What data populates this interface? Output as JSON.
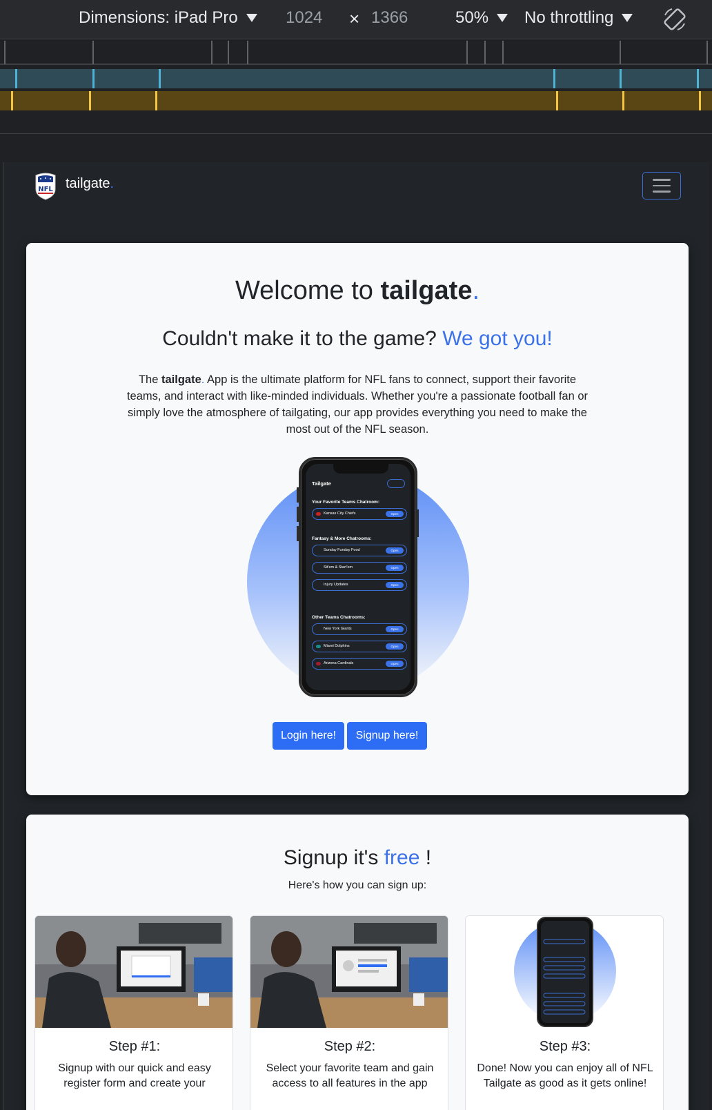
{
  "devtools": {
    "dimensions_label": "Dimensions: iPad Pro",
    "width_value": "1024",
    "times": "×",
    "height_value": "1366",
    "zoom": "50%",
    "throttling": "No throttling",
    "rotate_icon": "rotate-icon"
  },
  "navbar": {
    "brand": "tailgate",
    "brand_dot": ".",
    "logo_icon": "nfl-shield-icon",
    "menu_icon": "hamburger-icon"
  },
  "hero": {
    "title_prefix": "Welcome to ",
    "title_brand": "tailgate",
    "title_dot": ".",
    "subtitle_prefix": "Couldn't make it to the game? ",
    "subtitle_highlight": "We got you!",
    "para_prefix": "The ",
    "para_brand": "tailgate",
    "para_dot": ".",
    "para_rest": " App is the ultimate platform for NFL fans to connect, support their favorite teams, and interact with like-minded individuals. Whether you're a passionate football fan or simply love the atmosphere of tailgating, our app provides everything you need to make the most out of the NFL season.",
    "login_label": "Login here!",
    "signup_label": "Signup here!"
  },
  "phone": {
    "app_title": "Tailgate",
    "section1": "Your Favorite Teams Chatroom:",
    "section2": "Fantasy & More Chatrooms:",
    "section3": "Other Teams Chatrooms:",
    "open_label": "Open",
    "rows": {
      "r1": "Kansas City Chiefs",
      "r2": "Sunday Funday Food",
      "r3": "Sit'em & Start'em",
      "r4": "Injury Updates",
      "r5": "New York Giants",
      "r6": "Miami Dolphins",
      "r7": "Arizona Cardinals"
    }
  },
  "signup": {
    "title_prefix": "Signup it's ",
    "title_highlight": "free",
    "title_suffix": " !",
    "subtitle": "Here's how you can sign up:",
    "steps": [
      {
        "title": "Step #1:",
        "text": "Signup with our quick and easy register form and create your"
      },
      {
        "title": "Step #2:",
        "text": "Select your favorite team and gain access to all features in the app"
      },
      {
        "title": "Step #3:",
        "text": "Done! Now you can enjoy all of NFL Tailgate as good as it gets online!"
      }
    ]
  },
  "colors": {
    "accent": "#3b72e8",
    "button": "#2d6df6",
    "page_bg": "#212529",
    "card_bg": "#f8f9fa"
  }
}
